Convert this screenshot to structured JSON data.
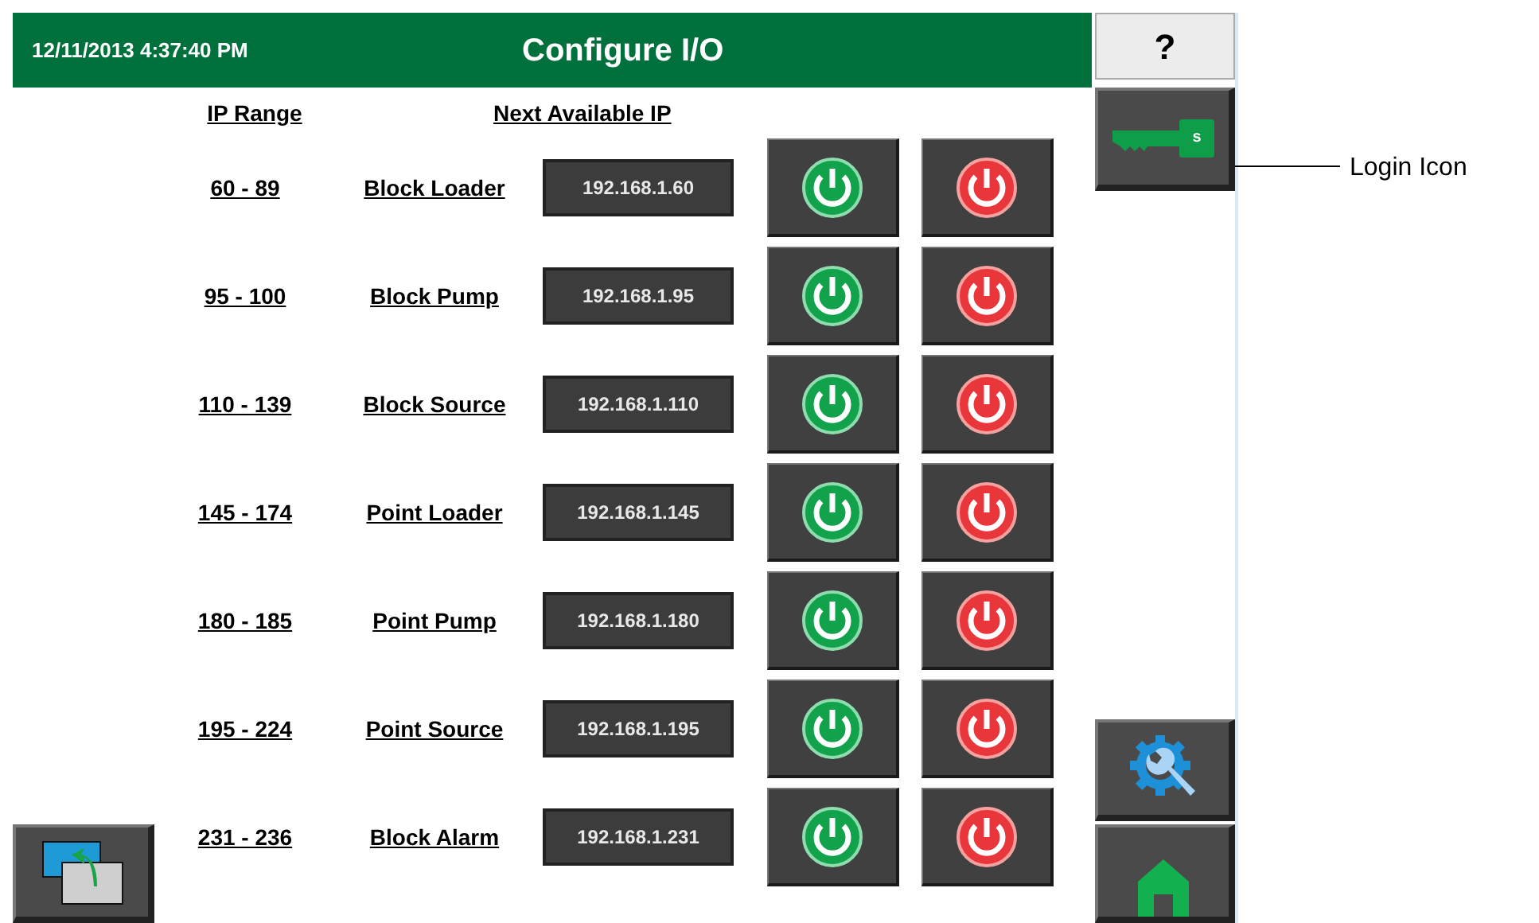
{
  "header": {
    "datetime": "12/11/2013 4:37:40 PM",
    "title": "Configure I/O"
  },
  "column_headings": {
    "range": "IP Range",
    "next_ip": "Next Available IP"
  },
  "devices": [
    {
      "range": "60 - 89",
      "name": "Block Loader",
      "next_ip": "192.168.1.60"
    },
    {
      "range": "95 - 100",
      "name": "Block Pump",
      "next_ip": "192.168.1.95"
    },
    {
      "range": "110 - 139",
      "name": "Block Source",
      "next_ip": "192.168.1.110"
    },
    {
      "range": "145 - 174",
      "name": "Point Loader",
      "next_ip": "192.168.1.145"
    },
    {
      "range": "180 - 185",
      "name": "Point Pump",
      "next_ip": "192.168.1.180"
    },
    {
      "range": "195 - 224",
      "name": "Point Source",
      "next_ip": "192.168.1.195"
    },
    {
      "range": "231 - 236",
      "name": "Block Alarm",
      "next_ip": "192.168.1.231"
    }
  ],
  "side_buttons": {
    "help": "?",
    "key_badge": "s"
  },
  "annotation": {
    "label": "Login Icon"
  }
}
